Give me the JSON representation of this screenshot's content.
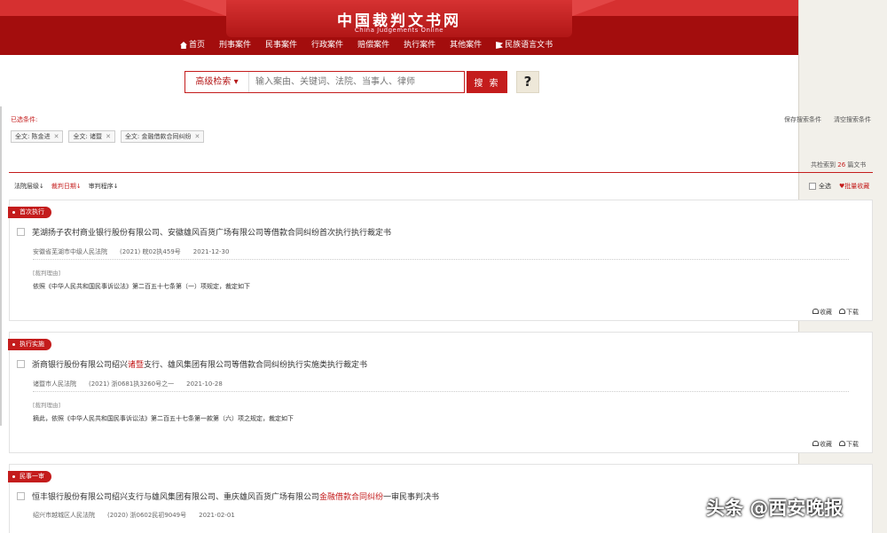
{
  "header": {
    "logo_cn": "中国裁判文书网",
    "logo_en": "China Judgements Online",
    "nav": [
      "首页",
      "刑事案件",
      "民事案件",
      "行政案件",
      "赔偿案件",
      "执行案件",
      "其他案件",
      "民族语言文书"
    ]
  },
  "search": {
    "type_label": "高级检索",
    "placeholder": "输入案由、关键词、法院、当事人、律师",
    "button": "搜 索",
    "help": "?"
  },
  "conditions": {
    "label": "已选条件:",
    "save": "保存搜索条件",
    "clear": "清空搜索条件",
    "tags": [
      "全文: 陈金进",
      "全文: 诸暨",
      "全文: 金融借款合同纠纷"
    ]
  },
  "results": {
    "prefix": "共检索到",
    "count": "26",
    "suffix": "篇文书"
  },
  "sort": {
    "items": [
      "法院层级",
      "裁判日期",
      "审判程序"
    ],
    "select_all": "全选",
    "batch_fav": "批量收藏"
  },
  "cards": [
    {
      "badge": "首次执行",
      "title_pre": "芜湖扬子农村商业银行股份有限公司、安徽雄风百货广场有限公司等借款合同纠纷首次执行执行裁定书",
      "title_hl": "",
      "title_post": "",
      "court": "安徽省芜湖市中级人民法院",
      "case_no": "(2021) 皖02执459号",
      "date": "2021-12-30",
      "reason_label": "[裁判理由]",
      "reason": "依照《中华人民共和国民事诉讼法》第二百五十七条第（一）项规定，裁定如下",
      "fav": "收藏",
      "download": "下载"
    },
    {
      "badge": "执行实施",
      "title_pre": "浙商银行股份有限公司绍兴",
      "title_hl": "诸暨",
      "title_post": "支行、雄风集团有限公司等借款合同纠纷执行实施类执行裁定书",
      "court": "诸暨市人民法院",
      "case_no": "(2021) 浙0681执3260号之一",
      "date": "2021-10-28",
      "reason_label": "[裁判理由]",
      "reason": "摘此，依照《中华人民共和国民事诉讼法》第二百五十七条第一款第（六）项之规定，裁定如下",
      "fav": "收藏",
      "download": "下载"
    },
    {
      "badge": "民事一审",
      "title_pre": "恒丰银行股份有限公司绍兴支行与雄风集团有限公司、重庆雄风百货广场有限公司",
      "title_hl": "金融借款合同纠纷",
      "title_post": "一审民事判决书",
      "court": "绍兴市越城区人民法院",
      "case_no": "(2020) 浙0602民初9049号",
      "date": "2021-02-01"
    }
  ],
  "watermark": "头条 @西安晚报"
}
